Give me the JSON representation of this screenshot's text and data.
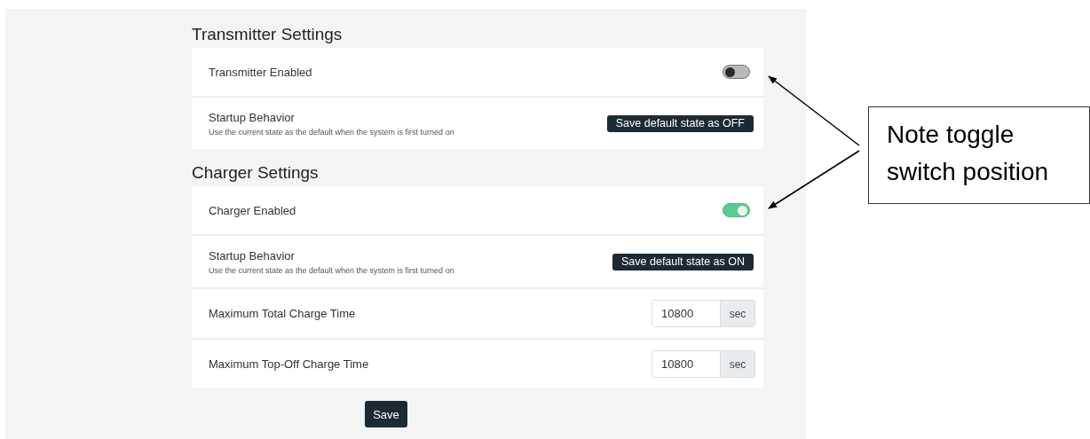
{
  "sections": [
    {
      "title": "Transmitter Settings",
      "rows": [
        {
          "kind": "toggle",
          "label": "Transmitter Enabled",
          "on": false
        },
        {
          "kind": "startup",
          "label": "Startup Behavior",
          "description": "Use the current state as the default when the system is first turned on",
          "button": "Save default state as OFF"
        }
      ]
    },
    {
      "title": "Charger Settings",
      "rows": [
        {
          "kind": "toggle",
          "label": "Charger Enabled",
          "on": true
        },
        {
          "kind": "startup",
          "label": "Startup Behavior",
          "description": "Use the current state as the default when the system is first turned on",
          "button": "Save default state as ON"
        },
        {
          "kind": "number",
          "label": "Maximum Total Charge Time",
          "value": "10800",
          "unit": "sec"
        },
        {
          "kind": "number",
          "label": "Maximum Top-Off Charge Time",
          "value": "10800",
          "unit": "sec"
        }
      ]
    }
  ],
  "save_button": "Save",
  "annotation": {
    "text": "Note toggle switch position"
  }
}
